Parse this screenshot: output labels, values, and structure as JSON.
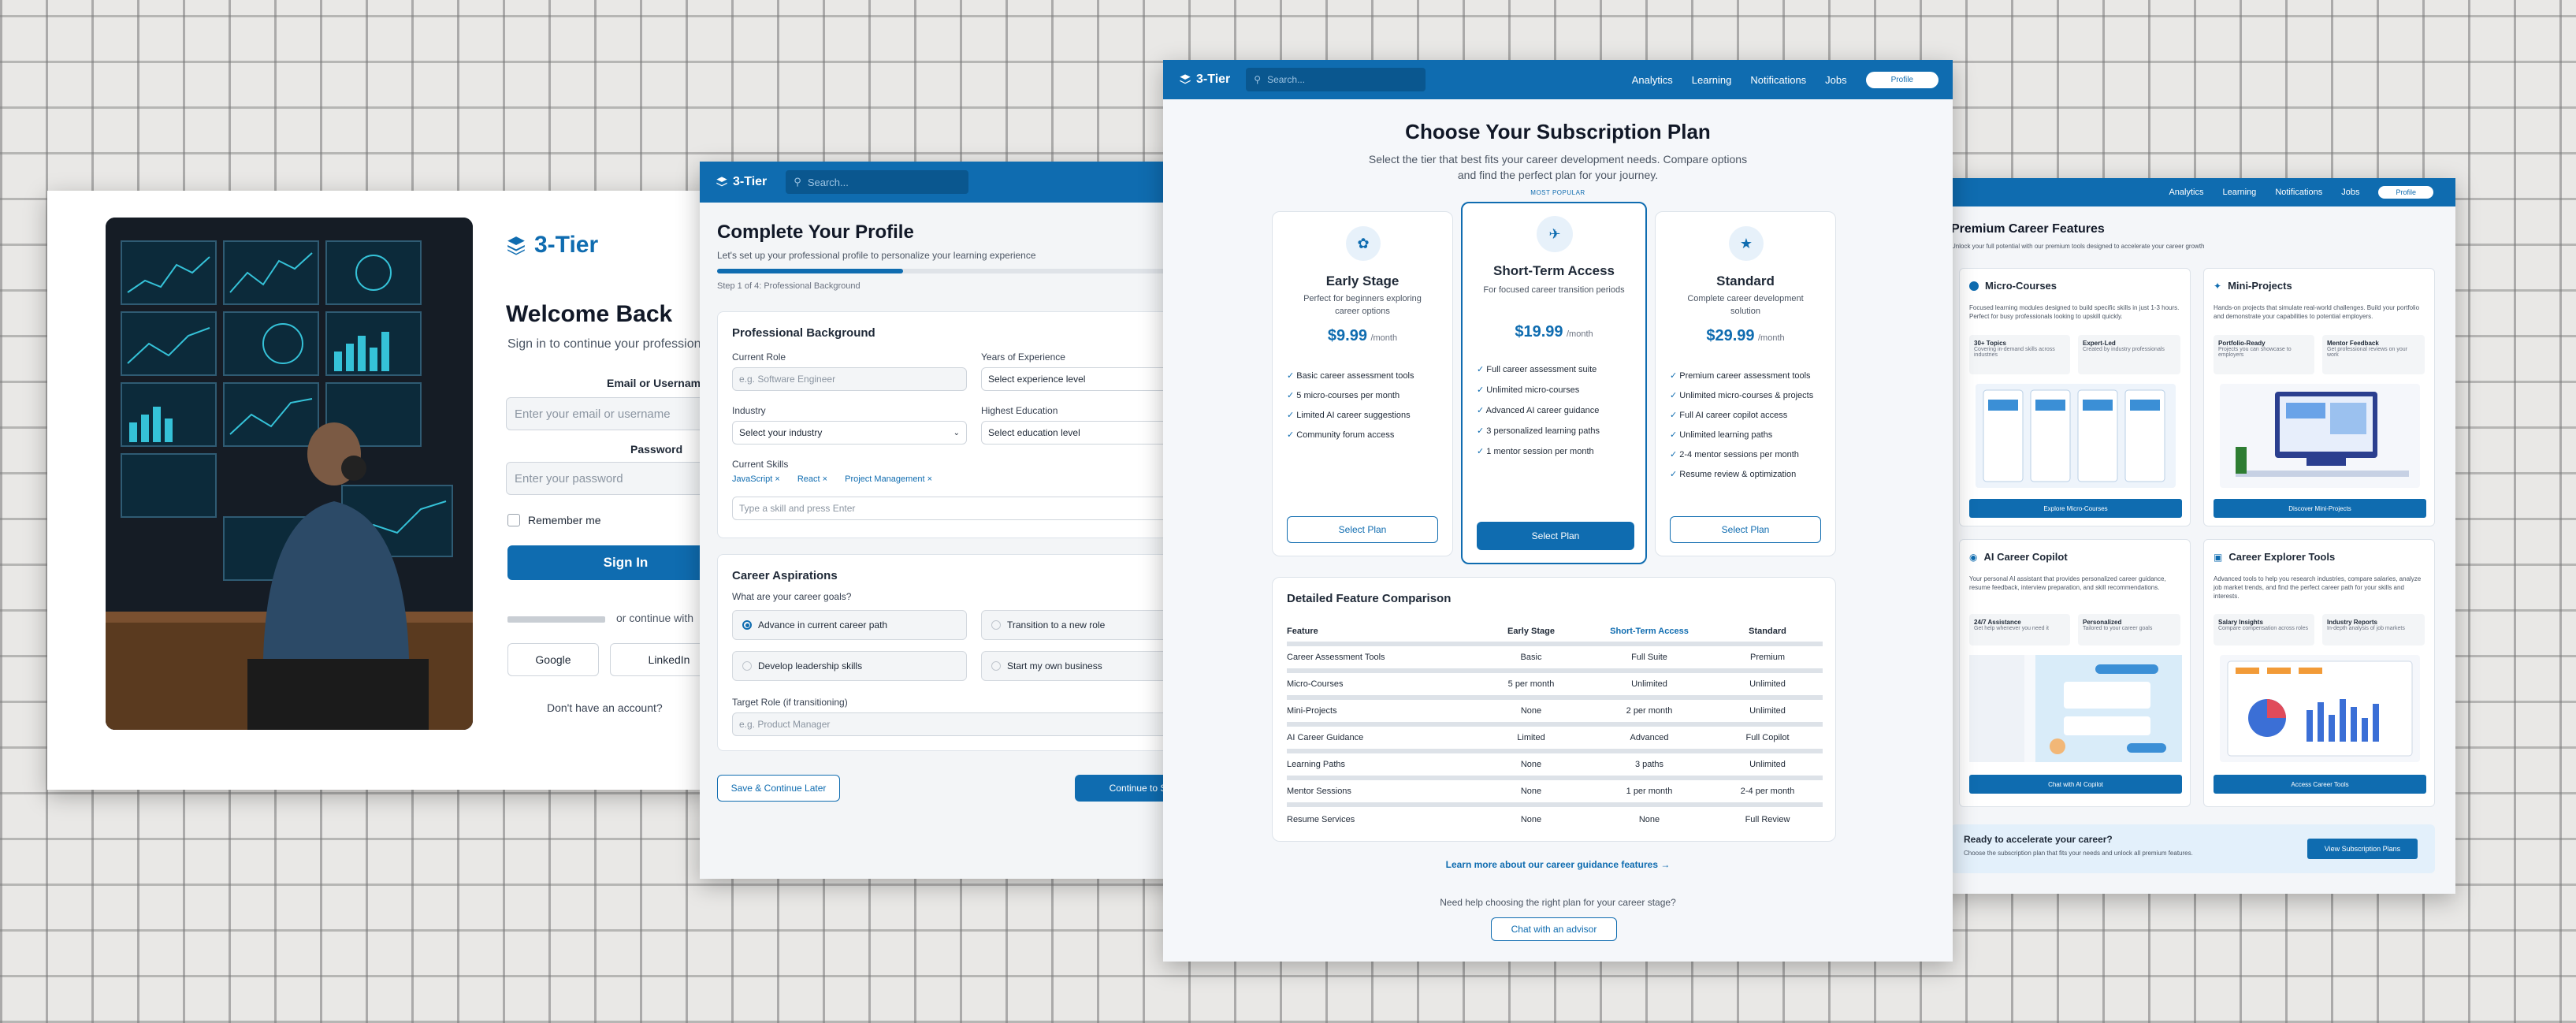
{
  "brand": {
    "name": "3-Tier",
    "primary": "#0f6cb0",
    "icon": "layers-icon"
  },
  "login": {
    "title": "Welcome Back",
    "subtitle": "Sign in to continue your profession",
    "email_label": "Email or Usernam",
    "email_placeholder": "Enter your email or username",
    "password_label": "Password",
    "password_placeholder": "Enter your password",
    "remember": "Remember me",
    "signin": "Sign In",
    "or_continue": "or continue with",
    "google": "Google",
    "linkedin": "LinkedIn",
    "no_account": "Don't have an account?"
  },
  "profile": {
    "search_placeholder": "Search...",
    "title": "Complete Your Profile",
    "subtitle": "Let's set up your professional profile to personalize your learning experience",
    "step": "Step 1 of 4: Professional Background",
    "progress_fraction": 0.25,
    "section1": "Professional Background",
    "current_role_label": "Current Role",
    "current_role_placeholder": "e.g. Software Engineer",
    "years_label": "Years of Experience",
    "years_value": "Select experience level",
    "industry_label": "Industry",
    "industry_value": "Select your industry",
    "education_label": "Highest Education",
    "education_value": "Select education level",
    "skills_label": "Current Skills",
    "skills": [
      "JavaScript",
      "React",
      "Project Management"
    ],
    "skills_placeholder": "Type a skill and press Enter",
    "section2": "Career Aspirations",
    "goals_question": "What are your career goals?",
    "goals": [
      "Advance in current career path",
      "Transition to a new role",
      "Develop leadership skills",
      "Start my own business"
    ],
    "target_label": "Target Role (if transitioning)",
    "target_placeholder": "e.g. Product Manager",
    "save_later": "Save & Continue Later",
    "continue": "Continue to Skills"
  },
  "pricing": {
    "search_placeholder": "Search...",
    "nav": [
      "Analytics",
      "Learning",
      "Notifications",
      "Jobs"
    ],
    "profile_btn": "Profile",
    "title": "Choose Your Subscription Plan",
    "subtitle1": "Select the tier that best fits your career development needs. Compare options",
    "subtitle2": "and find the perfect plan for your journey.",
    "most_popular": "MOST POPULAR",
    "per_month": "/month",
    "select": "Select Plan",
    "plans": [
      {
        "name": "Early Stage",
        "desc1": "Perfect for beginners exploring",
        "desc2": "career options",
        "price": "$9.99",
        "icon": "seedling-icon",
        "features": [
          "Basic career assessment tools",
          "5 micro-courses per month",
          "Limited AI career suggestions",
          "Community forum access"
        ]
      },
      {
        "name": "Short-Term Access",
        "desc1": "For focused career transition periods",
        "desc2": "",
        "price": "$19.99",
        "icon": "plane-icon",
        "features": [
          "Full career assessment suite",
          "Unlimited micro-courses",
          "Advanced AI career guidance",
          "3 personalized learning paths",
          "1 mentor session per month"
        ]
      },
      {
        "name": "Standard",
        "desc1": "Complete career development",
        "desc2": "solution",
        "price": "$29.99",
        "icon": "star-icon",
        "features": [
          "Premium career assessment tools",
          "Unlimited micro-courses & projects",
          "Full AI career copilot access",
          "Unlimited learning paths",
          "2-4 mentor sessions per month",
          "Resume review & optimization"
        ]
      }
    ],
    "comparison_title": "Detailed Feature Comparison",
    "comparison_headers": [
      "Feature",
      "Early Stage",
      "Short-Term Access",
      "Standard"
    ],
    "comparison_rows": [
      [
        "Career Assessment Tools",
        "Basic",
        "Full Suite",
        "Premium"
      ],
      [
        "Micro-Courses",
        "5 per month",
        "Unlimited",
        "Unlimited"
      ],
      [
        "Mini-Projects",
        "None",
        "2 per month",
        "Unlimited"
      ],
      [
        "AI Career Guidance",
        "Limited",
        "Advanced",
        "Full Copilot"
      ],
      [
        "Learning Paths",
        "None",
        "3 paths",
        "Unlimited"
      ],
      [
        "Mentor Sessions",
        "None",
        "1 per month",
        "2-4 per month"
      ],
      [
        "Resume Services",
        "None",
        "None",
        "Full Review"
      ]
    ],
    "learn_more": "Learn more about our career guidance features",
    "help": "Need help choosing the right plan for your career stage?",
    "chat_advisor": "Chat with an advisor"
  },
  "features": {
    "nav": [
      "Analytics",
      "Learning",
      "Notifications",
      "Jobs"
    ],
    "profile_btn": "Profile",
    "title": "Premium Career Features",
    "subtitle": "Unlock your full potential with our premium tools designed to accelerate your career growth",
    "cards": [
      {
        "title": "Micro-Courses",
        "desc": "Focused learning modules designed to build specific skills in just 1-3 hours. Perfect for busy professionals looking to upskill quickly.",
        "b1t": "30+ Topics",
        "b1d": "Covering in-demand skills across industries",
        "b2t": "Expert-Led",
        "b2d": "Created by industry professionals",
        "btn": "Explore Micro-Courses"
      },
      {
        "title": "Mini-Projects",
        "desc": "Hands-on projects that simulate real-world challenges. Build your portfolio and demonstrate your capabilities to potential employers.",
        "b1t": "Portfolio-Ready",
        "b1d": "Projects you can showcase to employers",
        "b2t": "Mentor Feedback",
        "b2d": "Get professional reviews on your work",
        "btn": "Discover Mini-Projects"
      },
      {
        "title": "AI Career Copilot",
        "desc": "Your personal AI assistant that provides personalized career guidance, resume feedback, interview preparation, and skill recommendations.",
        "b1t": "24/7 Assistance",
        "b1d": "Get help whenever you need it",
        "b2t": "Personalized",
        "b2d": "Tailored to your career goals",
        "btn": "Chat with AI Copilot"
      },
      {
        "title": "Career Explorer Tools",
        "desc": "Advanced tools to help you research industries, compare salaries, analyze job market trends, and find the perfect career path for your skills and interests.",
        "b1t": "Salary Insights",
        "b1d": "Compare compensation across roles",
        "b2t": "Industry Reports",
        "b2d": "In-depth analysis of job markets",
        "btn": "Access Career Tools"
      }
    ],
    "cta_title": "Ready to accelerate your career?",
    "cta_desc": "Choose the subscription plan that fits your needs and unlock all premium features.",
    "cta_btn": "View Subscription Plans"
  }
}
